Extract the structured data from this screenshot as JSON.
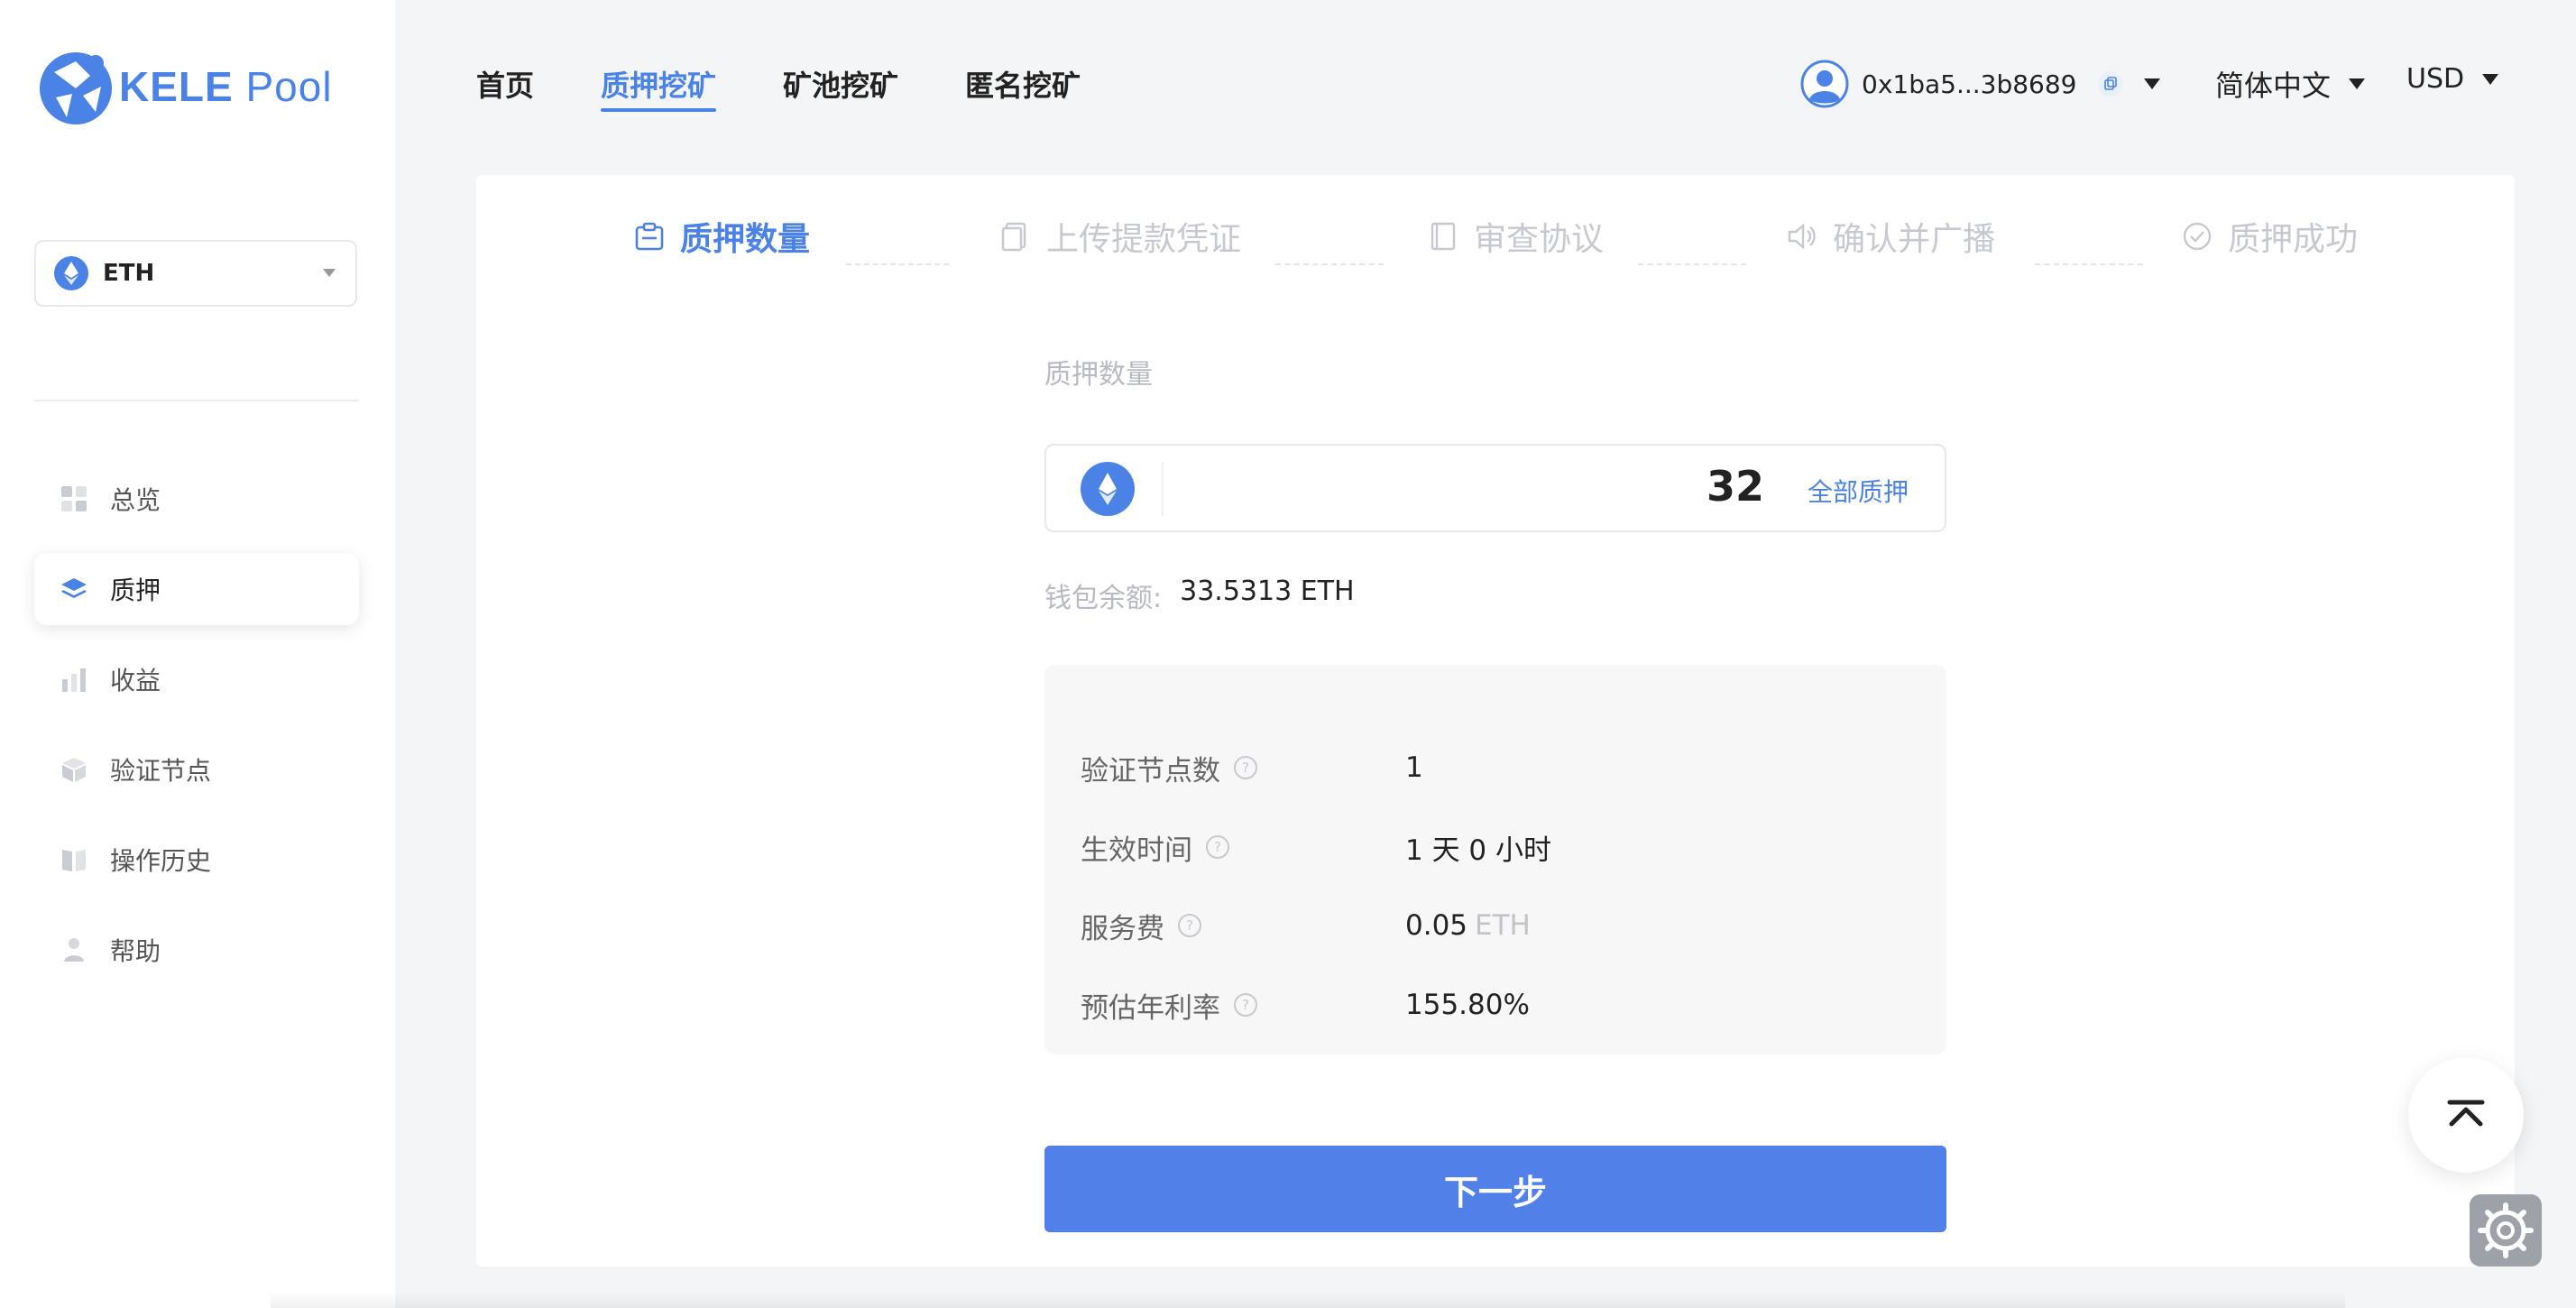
{
  "brand": {
    "name": "KELE",
    "suffix": "Pool",
    "color": "#4b82e6"
  },
  "sidebar": {
    "chain_selector": {
      "value": "ETH",
      "icon": "ethereum-icon"
    },
    "items": [
      {
        "label": "总览",
        "icon": "overview-grid-icon",
        "active": false
      },
      {
        "label": "质押",
        "icon": "stake-layers-icon",
        "active": true
      },
      {
        "label": "收益",
        "icon": "earnings-bar-icon",
        "active": false
      },
      {
        "label": "验证节点",
        "icon": "validator-cube-icon",
        "active": false
      },
      {
        "label": "操作历史",
        "icon": "history-book-icon",
        "active": false
      },
      {
        "label": "帮助",
        "icon": "help-person-icon",
        "active": false
      }
    ]
  },
  "header": {
    "tabs": [
      {
        "label": "首页",
        "active": false
      },
      {
        "label": "质押挖矿",
        "active": true
      },
      {
        "label": "矿池挖矿",
        "active": false
      },
      {
        "label": "匿名挖矿",
        "active": false
      }
    ],
    "account": {
      "address": "0x1ba5...3b8689"
    },
    "language": "简体中文",
    "currency": "USD"
  },
  "steps": [
    {
      "label": "质押数量",
      "icon": "clipboard-icon",
      "active": true
    },
    {
      "label": "上传提款凭证",
      "icon": "document-copy-icon",
      "active": false
    },
    {
      "label": "审查协议",
      "icon": "notebook-icon",
      "active": false
    },
    {
      "label": "确认并广播",
      "icon": "speaker-icon",
      "active": false
    },
    {
      "label": "质押成功",
      "icon": "check-circle-icon",
      "active": false
    }
  ],
  "form": {
    "title": "质押数量",
    "amount": "32",
    "stake_all": "全部质押",
    "balance_label": "钱包余额:",
    "balance_value": "33.5313 ETH",
    "details": [
      {
        "label": "验证节点数",
        "value": "1",
        "unit": ""
      },
      {
        "label": "生效时间",
        "value": "1 天 0 小时",
        "unit": ""
      },
      {
        "label": "服务费",
        "value": "0.05",
        "unit": "ETH"
      },
      {
        "label": "预估年利率",
        "value": "155.80%",
        "unit": ""
      }
    ],
    "next_button": "下一步"
  },
  "colors": {
    "accent": "#4b82e6",
    "button": "#5180e9",
    "muted": "#c6c9cf"
  }
}
